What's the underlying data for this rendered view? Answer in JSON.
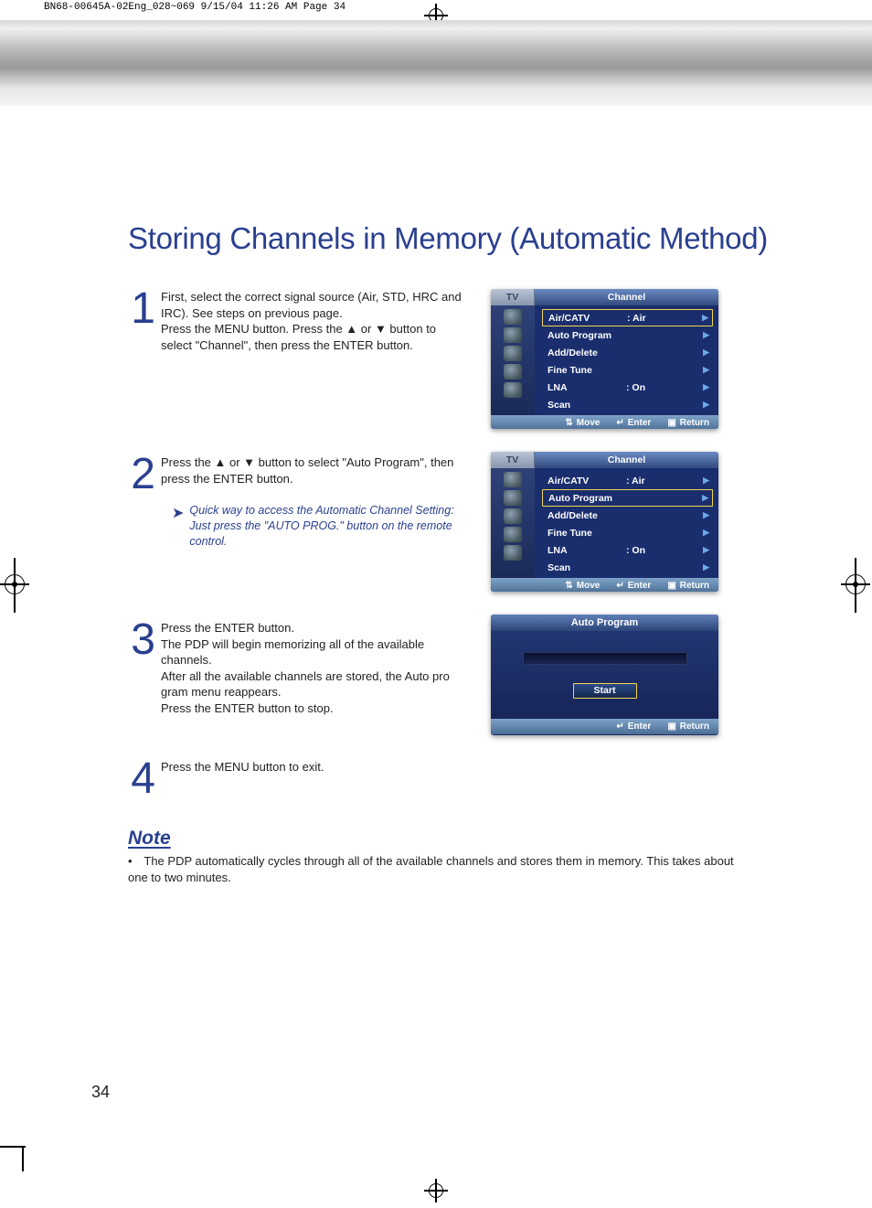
{
  "header_strip": "BN68-00645A-02Eng_028~069  9/15/04  11:26 AM  Page 34",
  "title": "Storing Channels in Memory (Automatic Method)",
  "steps": {
    "s1": {
      "num": "1",
      "text": "First, select the correct signal source (Air, STD, HRC and IRC). See steps on previous page.\nPress the MENU button. Press the ▲ or ▼ button to select \"Channel\", then press the ENTER button."
    },
    "s2": {
      "num": "2",
      "text": "Press the ▲ or ▼ button to select \"Auto Program\", then press the ENTER button.",
      "tip": "Quick way to access the Automatic Channel Setting: Just press the \"AUTO PROG.\" button on the remote control."
    },
    "s3": {
      "num": "3",
      "text": "Press the ENTER button.\nThe PDP will begin memorizing all of the available channels.\nAfter all the available channels are stored, the Auto pro gram menu reappears.\nPress the ENTER button to stop."
    },
    "s4": {
      "num": "4",
      "text": "Press the MENU button to exit."
    }
  },
  "note": {
    "heading": "Note",
    "body": "The PDP automatically cycles through all of the available channels and stores them in memory. This takes about one to two minutes."
  },
  "page_number": "34",
  "osd": {
    "tv_label": "TV",
    "channel_label": "Channel",
    "items": {
      "air_catv": {
        "label": "Air/CATV",
        "value": ":   Air"
      },
      "auto_program": {
        "label": "Auto Program",
        "value": ""
      },
      "add_delete": {
        "label": "Add/Delete",
        "value": ""
      },
      "fine_tune": {
        "label": "Fine Tune",
        "value": ""
      },
      "lna": {
        "label": "LNA",
        "value": ":   On"
      },
      "scan": {
        "label": "Scan",
        "value": ""
      }
    },
    "footer": {
      "move": "Move",
      "enter": "Enter",
      "return": "Return"
    },
    "auto_program": {
      "title": "Auto Program",
      "start": "Start"
    }
  }
}
